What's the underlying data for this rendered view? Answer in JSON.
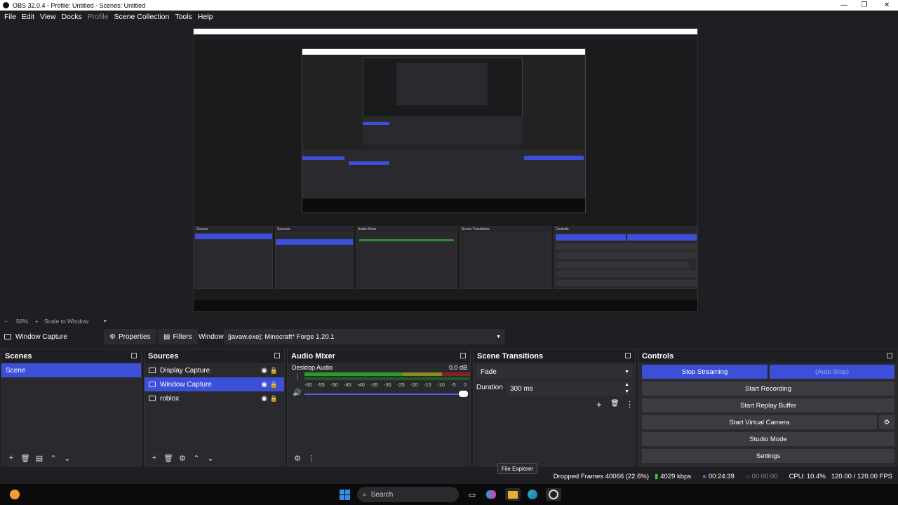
{
  "window": {
    "title": "OBS 32.0.4 - Profile: Untitled - Scenes: Untitled",
    "minimize": "—",
    "maximize": "❐",
    "close": "✕"
  },
  "menu": [
    "File",
    "Edit",
    "View",
    "Docks",
    "Profile",
    "Scene Collection",
    "Tools",
    "Help"
  ],
  "preview_toolbar": {
    "zoom": "56%",
    "zoom_minus": "−",
    "zoom_plus": "+",
    "scale_mode": "Scale to Window"
  },
  "source_toolbar": {
    "source_name": "Window Capture",
    "properties_label": "Properties",
    "filters_label": "Filters",
    "window_label": "Window",
    "window_value": "[javaw.exe]: Minecraft* Forge 1.20.1"
  },
  "scenes": {
    "title": "Scenes",
    "items": [
      {
        "label": "Scene"
      }
    ]
  },
  "sources": {
    "title": "Sources",
    "items": [
      {
        "label": "Display Capture"
      },
      {
        "label": "Window Capture"
      },
      {
        "label": "roblox"
      }
    ]
  },
  "audio_mixer": {
    "title": "Audio Mixer",
    "channel": "Desktop Audio",
    "level": "0.0 dB",
    "ticks": [
      "-60",
      "-55",
      "-50",
      "-45",
      "-40",
      "-35",
      "-30",
      "-25",
      "-20",
      "-15",
      "-10",
      "-5",
      "0"
    ]
  },
  "scene_transitions": {
    "title": "Scene Transitions",
    "transition": "Fade",
    "duration_label": "Duration",
    "duration_value": "300 ms"
  },
  "controls": {
    "title": "Controls",
    "stop_streaming": "Stop Streaming",
    "auto_stop": "(Auto Stop)",
    "start_recording": "Start Recording",
    "start_replay_buffer": "Start Replay Buffer",
    "start_virtual_camera": "Start Virtual Camera",
    "studio_mode": "Studio Mode",
    "settings": "Settings"
  },
  "status": {
    "dropped_frames": "Dropped Frames 40066 (22.6%)",
    "bitrate": "4029 kbps",
    "stream_time": "00:24:39",
    "record_time": "00:00:00",
    "cpu": "CPU: 10.4%",
    "fps": "120.00 / 120.00 FPS"
  },
  "taskbar": {
    "search_placeholder": "Search",
    "tooltip": "File Explorer"
  },
  "colors": {
    "accent": "#3b4fd8",
    "background": "#1f1f23",
    "dock": "#2a2a2e",
    "button": "#3b3b40"
  }
}
